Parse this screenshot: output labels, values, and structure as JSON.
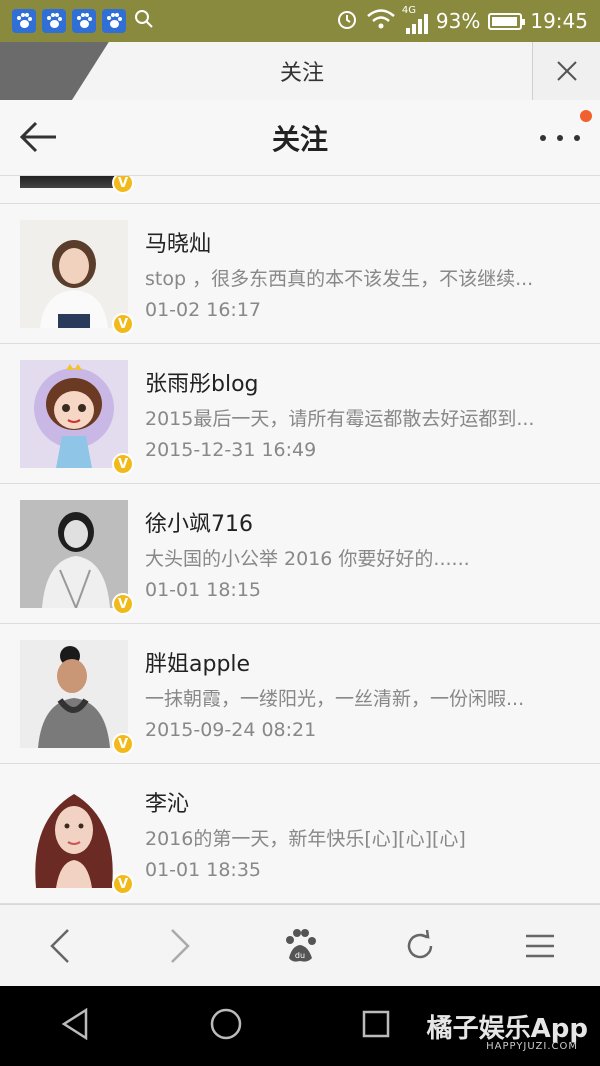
{
  "status_bar": {
    "network": "4G",
    "battery": "93%",
    "battery_level": 0.93,
    "time": "19:45"
  },
  "browser_tab": {
    "title": "关注"
  },
  "header": {
    "title": "关注"
  },
  "follow_list": [
    {
      "name": "马晓灿",
      "snippet": "stop ，很多东西真的本不该发生，不该继续...",
      "time": "01-02 16:17",
      "avatar": "woman-white-top",
      "verified_badge": "V"
    },
    {
      "name": "张雨彤blog",
      "snippet": "2015最后一天，请所有霉运都散去好运都到...",
      "time": "2015-12-31 16:49",
      "avatar": "cartoon-girl",
      "verified_badge": "V"
    },
    {
      "name": "徐小飒716",
      "snippet": "大头国的小公举 2016 你要好好的......",
      "time": "01-01 18:15",
      "avatar": "bw-portrait",
      "verified_badge": "V"
    },
    {
      "name": "胖姐apple",
      "snippet": "一抹朝霞，一缕阳光，一丝清新，一份闲暇...",
      "time": "2015-09-24 08:21",
      "avatar": "woman-bun",
      "verified_badge": "V"
    },
    {
      "name": "李沁",
      "snippet": "2016的第一天，新年快乐[心][心][心]",
      "time": "01-01 18:35",
      "avatar": "woman-long-hair",
      "verified_badge": "V"
    }
  ],
  "toolbar": {
    "back": "back-icon",
    "forward": "forward-icon",
    "home": "baidu-paw-icon",
    "refresh": "refresh-icon",
    "menu": "menu-icon"
  },
  "watermark": {
    "main": "橘子娱乐App",
    "sub": "HAPPYJUZI.COM"
  }
}
